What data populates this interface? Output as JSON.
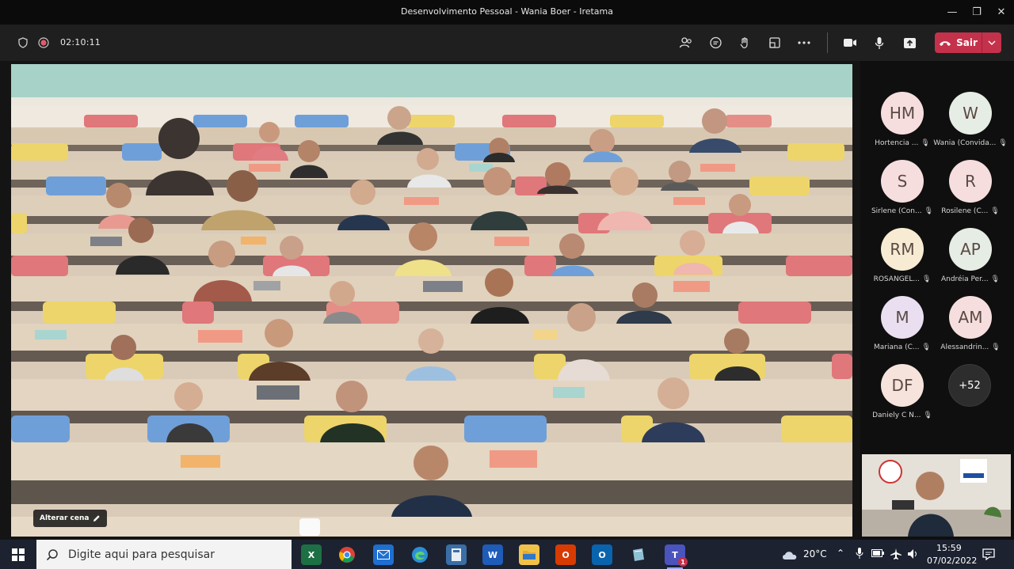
{
  "window": {
    "title": "Desenvolvimento Pessoal - Wania Boer - Iretama"
  },
  "toolbar": {
    "timer": "02:10:11",
    "leave_label": "Sair"
  },
  "stage": {
    "change_scene_label": "Alterar cena"
  },
  "participants": [
    {
      "initials": "HM",
      "name": "Hortencia ...",
      "color": "#f6dede"
    },
    {
      "initials": "W",
      "name": "Wania (Convida...",
      "color": "#e6ede4"
    },
    {
      "initials": "S",
      "name": "Sirlene (Con...",
      "color": "#f6dede"
    },
    {
      "initials": "R",
      "name": "Rosilene (C...",
      "color": "#f6dede"
    },
    {
      "initials": "RM",
      "name": "ROSANGEL...",
      "color": "#f7ecd3"
    },
    {
      "initials": "AP",
      "name": "Andréia Per...",
      "color": "#e6ede4"
    },
    {
      "initials": "M",
      "name": "Mariana (C...",
      "color": "#eadff0"
    },
    {
      "initials": "AM",
      "name": "Alessandrin...",
      "color": "#f6dede"
    },
    {
      "initials": "DF",
      "name": "Daniely C N...",
      "color": "#f6e3dc"
    }
  ],
  "more_participants": "+52",
  "taskbar": {
    "search_placeholder": "Digite aqui para pesquisar",
    "temperature": "20°C",
    "time": "15:59",
    "date": "07/02/2022",
    "teams_badge": "1"
  }
}
